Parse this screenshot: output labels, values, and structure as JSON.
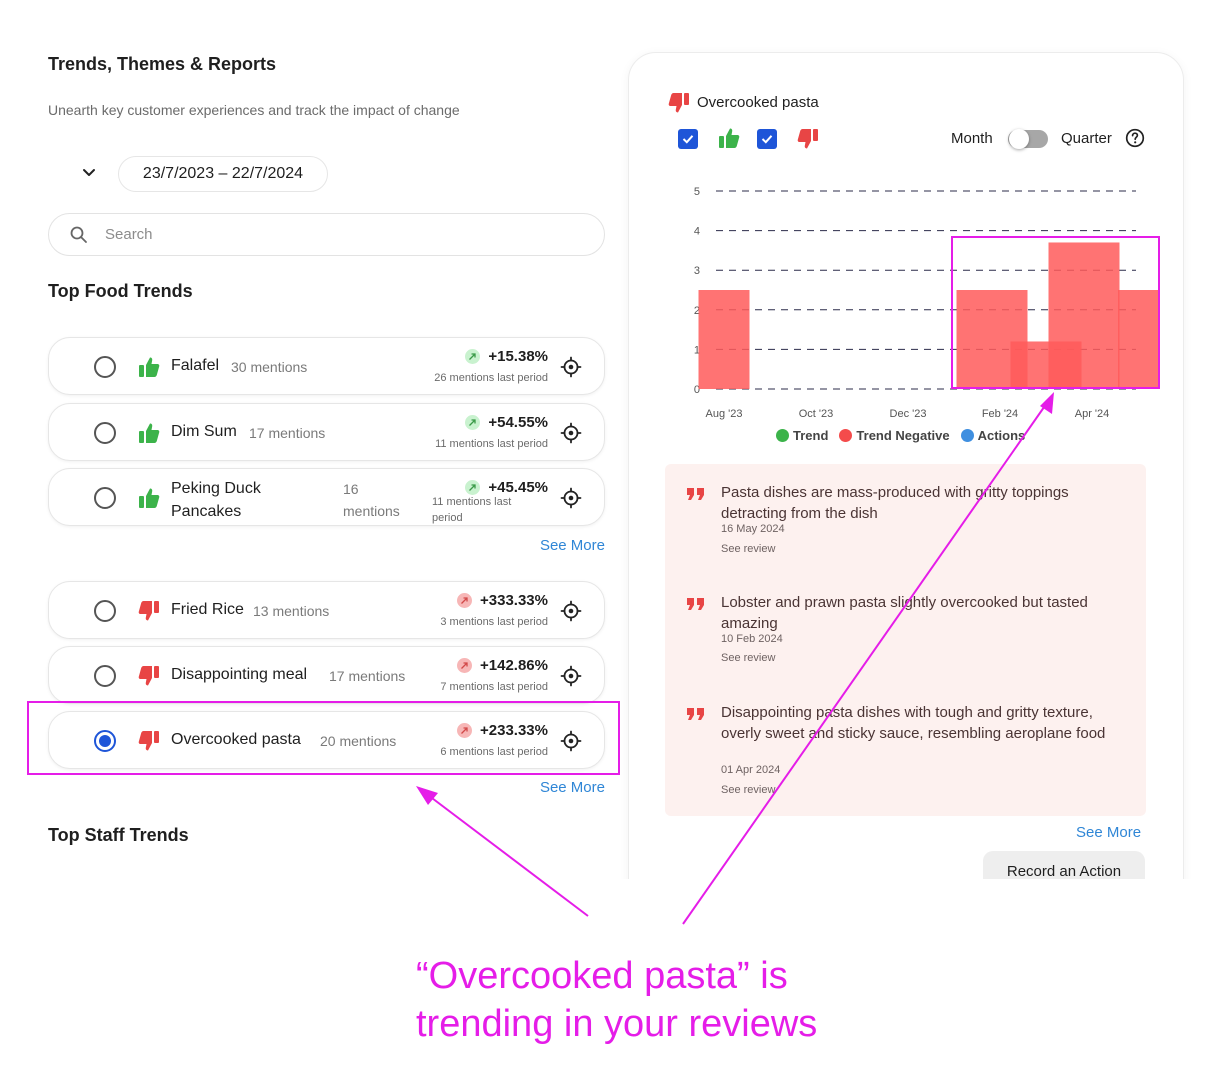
{
  "header": {
    "title": "Trends, Themes & Reports",
    "subtitle": "Unearth key customer experiences and track the impact of change",
    "date_range": "23/7/2023 – 22/7/2024"
  },
  "search": {
    "placeholder": "Search"
  },
  "food_section": {
    "title": "Top Food Trends",
    "positive": [
      {
        "name": "Falafel",
        "mentions": "30 mentions",
        "pct": "+15.38%",
        "last": "26 mentions last period",
        "sentiment": "positive"
      },
      {
        "name": "Dim Sum",
        "mentions": "17 mentions",
        "pct": "+54.55%",
        "last": "11 mentions last period",
        "sentiment": "positive"
      },
      {
        "name": "Peking Duck Pancakes",
        "mentions": "16 mentions",
        "pct": "+45.45%",
        "last": "11 mentions last period",
        "sentiment": "positive"
      }
    ],
    "negative": [
      {
        "name": "Fried Rice",
        "mentions": "13 mentions",
        "pct": "+333.33%",
        "last": "3 mentions last period",
        "sentiment": "negative"
      },
      {
        "name": "Disappointing meal",
        "mentions": "17 mentions",
        "pct": "+142.86%",
        "last": "7 mentions last period",
        "sentiment": "negative"
      },
      {
        "name": "Overcooked pasta",
        "mentions": "20 mentions",
        "pct": "+233.33%",
        "last": "6 mentions last period",
        "sentiment": "negative",
        "selected": true
      }
    ],
    "see_more": "See More"
  },
  "staff_section": {
    "title": "Top Staff Trends"
  },
  "detail": {
    "title": "Overcooked pasta",
    "toggle": {
      "left": "Month",
      "right": "Quarter",
      "value": "Month"
    },
    "legend": [
      "Trend",
      "Trend Negative",
      "Actions"
    ],
    "reviews": [
      {
        "text": "Pasta dishes are mass-produced with gritty toppings detracting from the dish",
        "date": "16 May 2024",
        "link": "See review"
      },
      {
        "text": "Lobster and prawn pasta slightly overcooked but tasted amazing",
        "date": "10 Feb 2024",
        "link": "See review"
      },
      {
        "text": "Disappointing pasta dishes with tough and gritty texture, overly sweet and sticky sauce, resembling aeroplane food",
        "date": "01 Apr 2024",
        "link": "See review"
      }
    ],
    "see_more": "See More",
    "record_action": "Record an Action"
  },
  "annotation": {
    "caption_line1": "“Overcooked pasta” is",
    "caption_line2": "trending in your reviews"
  },
  "colors": {
    "accent_magenta": "#e51de8",
    "bar_red": "#ff6b6b",
    "positive_green": "#3cb34a",
    "negative_red": "#e84545",
    "link_blue": "#2f86d6",
    "checkbox_blue": "#1e55d8"
  },
  "chart_data": {
    "type": "bar",
    "x_ticks": [
      "Aug '23",
      "Oct '23",
      "Dec '23",
      "Feb '24",
      "Apr '24"
    ],
    "y_ticks": [
      0,
      1,
      2,
      3,
      4,
      5
    ],
    "ylim": [
      0,
      5
    ],
    "grid": true,
    "legend_position": "bottom",
    "series": [
      {
        "name": "Trend Negative",
        "points": [
          {
            "x": "Aug '23",
            "value": 2.5
          },
          {
            "x": "Feb '24",
            "value": 2.5
          },
          {
            "x": "Mar '24",
            "value": 1.2
          },
          {
            "x": "Apr '24",
            "value": 3.7
          },
          {
            "x": "May '24",
            "value": 2.5
          }
        ]
      }
    ]
  }
}
